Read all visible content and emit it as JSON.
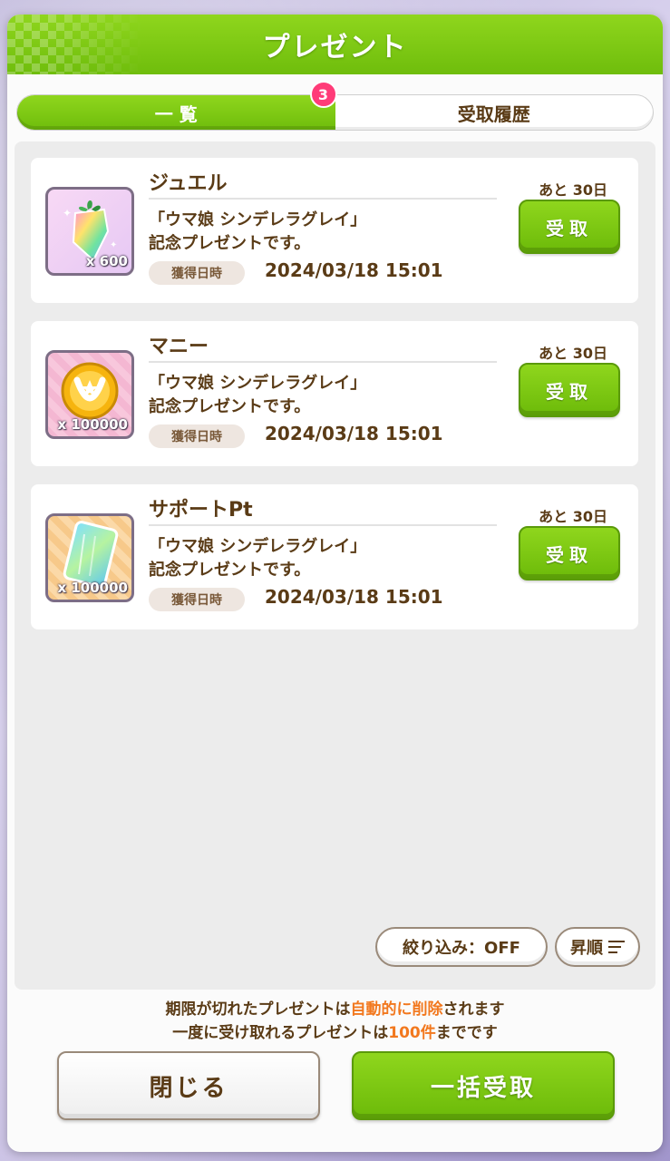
{
  "header": {
    "title": "プレゼント"
  },
  "tabs": [
    {
      "label": "一 覧",
      "badge": "3",
      "active": true
    },
    {
      "label": "受取履歴",
      "active": false
    }
  ],
  "items": [
    {
      "name": "ジュエル",
      "quantity": "x 600",
      "icon": "jewel-icon",
      "description_line1": "「ウマ娘 シンデレラグレイ」",
      "description_line2": "記念プレゼントです。",
      "date_label": "獲得日時",
      "date": "2024/03/18 15:01",
      "remaining": "あと 30日",
      "button_label": "受取"
    },
    {
      "name": "マニー",
      "quantity": "x 100000",
      "icon": "coin-icon",
      "description_line1": "「ウマ娘 シンデレラグレイ」",
      "description_line2": "記念プレゼントです。",
      "date_label": "獲得日時",
      "date": "2024/03/18 15:01",
      "remaining": "あと 30日",
      "button_label": "受取"
    },
    {
      "name": "サポートPt",
      "quantity": "x 100000",
      "icon": "support-pt-icon",
      "description_line1": "「ウマ娘 シンデレラグレイ」",
      "description_line2": "記念プレゼントです。",
      "date_label": "獲得日時",
      "date": "2024/03/18 15:01",
      "remaining": "あと 30日",
      "button_label": "受取"
    }
  ],
  "filters": {
    "filter_label": "絞り込み：OFF",
    "sort_label": "昇順"
  },
  "notice": {
    "line1_a": "期限が切れたプレゼントは",
    "line1_hl": "自動的に削除",
    "line1_b": "されます",
    "line2_a": "一度に受け取れるプレゼントは",
    "line2_hl": "100件",
    "line2_b": "までです"
  },
  "footer": {
    "close_label": "閉じる",
    "receive_all_label": "一括受取"
  },
  "colors": {
    "accent_green": "#7cc914",
    "text_brown": "#5a3b16",
    "badge_pink": "#ff3b78",
    "highlight_orange": "#f2781e"
  }
}
